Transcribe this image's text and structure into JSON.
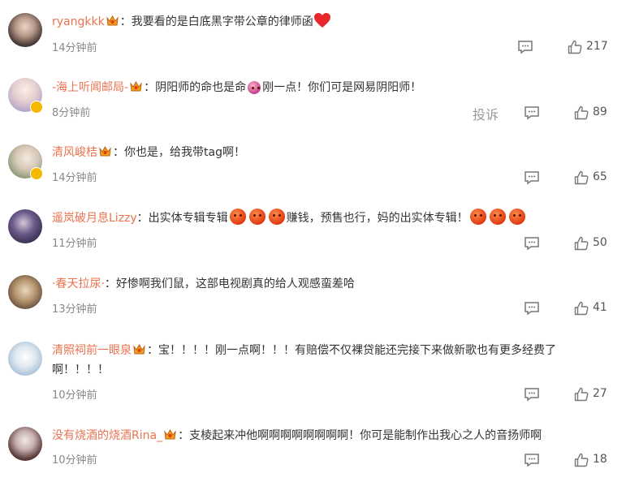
{
  "comments": [
    {
      "name": "ryangkkk",
      "text": "：我要看的是白底黑字带公章的律师函",
      "time": "14分钟前",
      "likes": "217"
    },
    {
      "name": "-海上听闻邮局-",
      "text_pre": "：阴阳师的命也是命",
      "text_post": "刚一点！你们可是网易阴阳师！",
      "time": "8分钟前",
      "likes": "89",
      "report": "投诉"
    },
    {
      "name": "清风峻桔",
      "text": "：你也是，给我带tag啊！",
      "time": "14分钟前",
      "likes": "65"
    },
    {
      "name": "遥岚破月息Lizzy",
      "text_a": "：出实体专辑专辑",
      "text_b": "赚钱，预售也行，妈的出实体专辑！",
      "time": "11分钟前",
      "likes": "50"
    },
    {
      "name": "·春天拉尿·",
      "text": "：好惨啊我们鼠，这部电视剧真的给人观感蛮差哈",
      "time": "13分钟前",
      "likes": "41"
    },
    {
      "name": "清照祠前一眼泉",
      "text": "：宝！！！！刚一点啊！！！有赔偿不仅裸贷能还完接下来做新歌也有更多经费了",
      "text_cont": "啊！！！！",
      "time": "10分钟前",
      "likes": "27"
    },
    {
      "name": "没有烧酒的烧酒Rina_",
      "text": "：支棱起来冲他啊啊啊啊啊啊啊啊！你可是能制作出我心之人的音扬师啊",
      "time": "10分钟前",
      "likes": "18"
    }
  ],
  "colors": {
    "name": "#eb7350",
    "text": "#333333",
    "time": "#888888",
    "badge": "#f5b800"
  },
  "icons": {
    "reply": "comment-icon",
    "like": "thumbs-up-icon",
    "crown": "crown-badge-icon",
    "verified": "verified-badge-icon"
  }
}
